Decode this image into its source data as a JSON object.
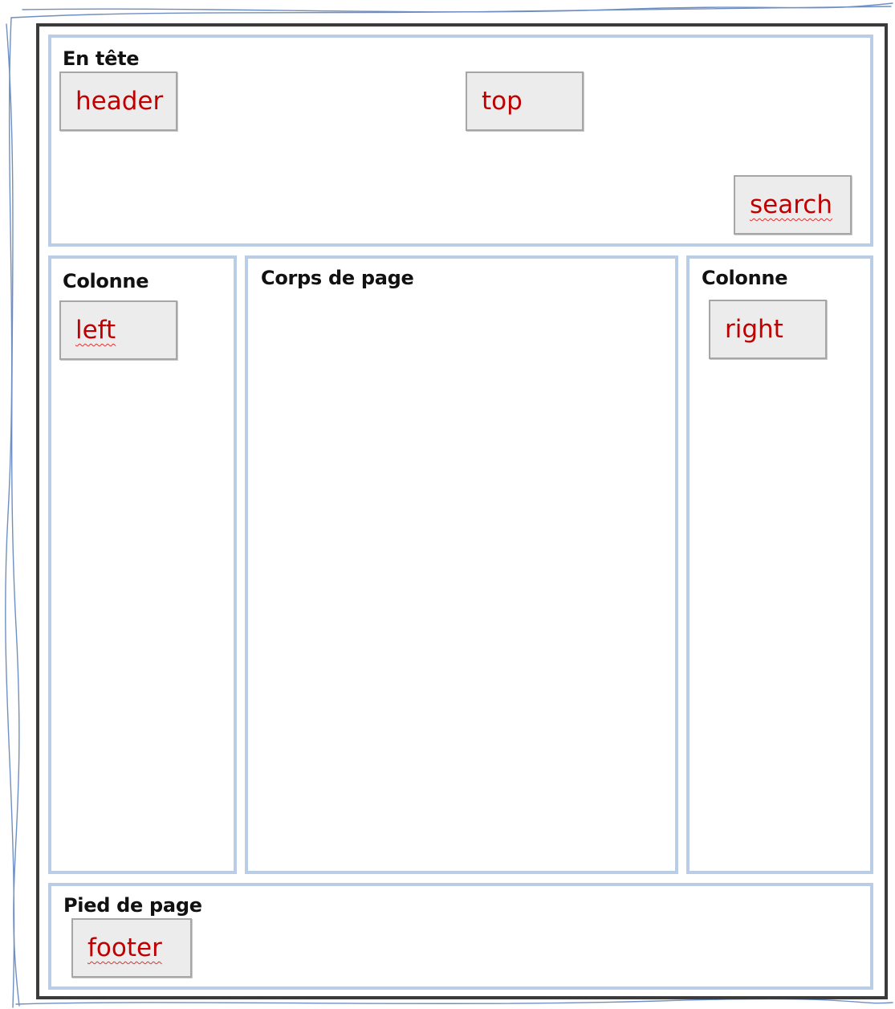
{
  "regions": {
    "header": {
      "title": "En tête",
      "tags": {
        "header": "header",
        "top": "top",
        "search": "search"
      }
    },
    "left": {
      "title": "Colonne",
      "tag": "left"
    },
    "main": {
      "title": "Corps de page"
    },
    "right": {
      "title": "Colonne",
      "tag": "right"
    },
    "footer": {
      "title": "Pied de page",
      "tag": "footer"
    }
  },
  "colors": {
    "frame": "#3b3b3b",
    "region_border": "#b9cde6",
    "tag_text": "#c00000",
    "tag_fill": "#ececec",
    "sketch_line": "#6f8fc2"
  }
}
